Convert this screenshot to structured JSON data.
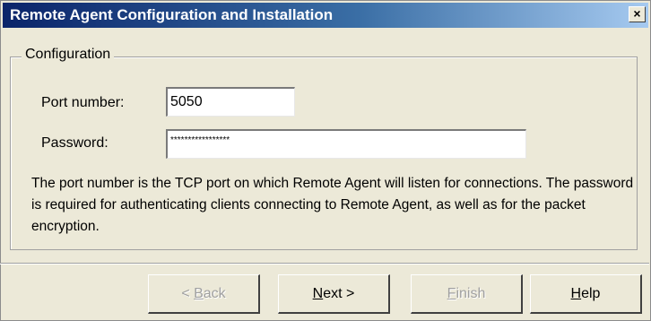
{
  "window": {
    "title": "Remote Agent Configuration and Installation",
    "close_glyph": "×"
  },
  "config": {
    "group_label": "Configuration",
    "port_label": "Port number:",
    "port_value": "5050",
    "password_label": "Password:",
    "password_value": "*****************",
    "description": "The port number is the TCP port on which Remote Agent will listen for connections. The password is required for authenticating clients connecting to Remote Agent, as well as for the packet encryption."
  },
  "buttons": {
    "back": {
      "prefix": "< ",
      "key": "B",
      "rest": "ack",
      "enabled": false
    },
    "next": {
      "prefix": "",
      "key": "N",
      "rest": "ext >",
      "enabled": true
    },
    "finish": {
      "prefix": "",
      "key": "F",
      "rest": "inish",
      "enabled": false
    },
    "help": {
      "prefix": "",
      "key": "H",
      "rest": "elp",
      "enabled": true
    }
  },
  "colors": {
    "titlebar_start": "#0a246a",
    "titlebar_end": "#a6caf0",
    "dialog_bg": "#ece9d8"
  }
}
